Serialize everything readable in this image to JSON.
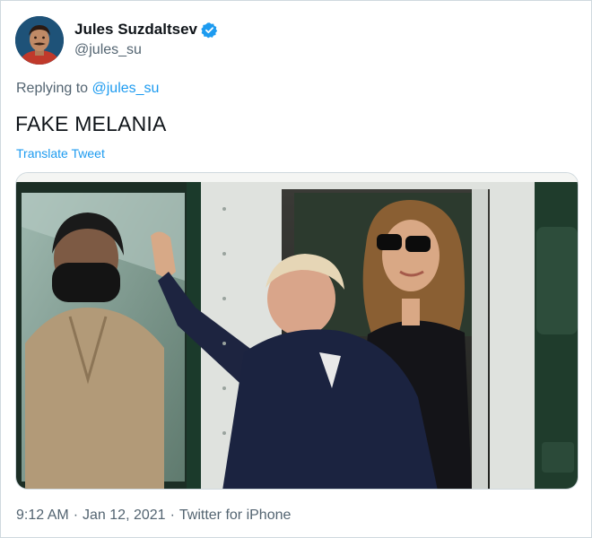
{
  "author": {
    "display_name": "Jules Suzdaltsev",
    "handle": "@jules_su",
    "verified": true,
    "avatar_icon": "profile-photo"
  },
  "reply": {
    "prefix": "Replying to",
    "mention": "@jules_su"
  },
  "tweet": {
    "text": "FAKE MELANIA",
    "translate_label": "Translate Tweet"
  },
  "media": {
    "kind": "photo"
  },
  "meta": {
    "time": "9:12 AM",
    "separator": "·",
    "date": "Jan 12, 2021",
    "source": "Twitter for iPhone"
  },
  "colors": {
    "link": "#1d9bf0",
    "secondary_text": "#536471",
    "border": "#cfd9de"
  }
}
